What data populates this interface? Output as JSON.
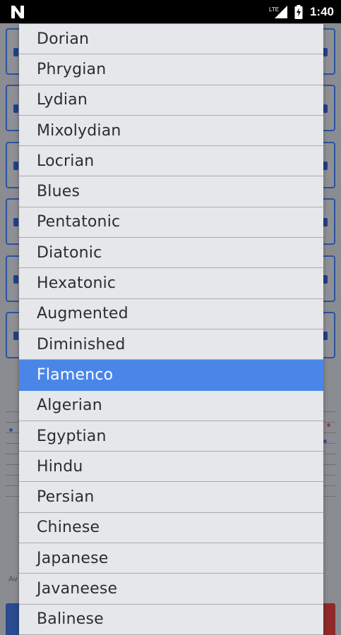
{
  "status_bar": {
    "time": "1:40",
    "network_label": "LTE",
    "icons": [
      "n-notification-icon",
      "lte-signal-icon",
      "battery-charging-icon"
    ]
  },
  "scale_dropdown": {
    "selected_index": 11,
    "options": [
      "Dorian",
      "Phrygian",
      "Lydian",
      "Mixolydian",
      "Locrian",
      "Blues",
      "Pentatonic",
      "Diatonic",
      "Hexatonic",
      "Augmented",
      "Diminished",
      "Flamenco",
      "Algerian",
      "Egyptian",
      "Hindu",
      "Persian",
      "Chinese",
      "Japanese",
      "Javaneese",
      "Balinese"
    ]
  },
  "background": {
    "partial_label": "Av"
  },
  "colors": {
    "selected": "#4a86e8",
    "list_bg": "#e6e7eb",
    "accent_blue": "#2d52a0",
    "accent_red": "#8f2a2a"
  }
}
